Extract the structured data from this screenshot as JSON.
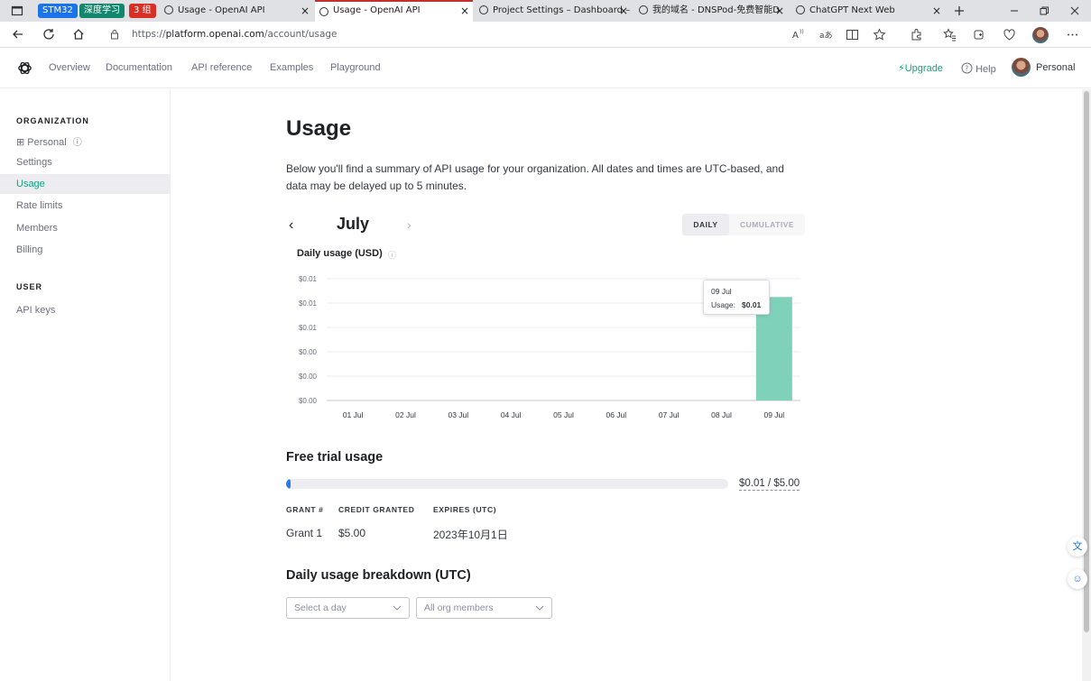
{
  "browser": {
    "tab_groups": [
      {
        "label": "STM32",
        "color": "#1a73e8"
      },
      {
        "label": "深度学习",
        "color": "#12876e"
      },
      {
        "label": "3 组",
        "color": "#d93025"
      }
    ],
    "tabs": [
      {
        "title": "Usage - OpenAI API",
        "active": false
      },
      {
        "title": "Usage - OpenAI API",
        "active": true
      },
      {
        "title": "Project Settings – Dashboard – ",
        "active": false
      },
      {
        "title": "我的域名 - DNSPod-免费智能D",
        "active": false
      },
      {
        "title": "ChatGPT Next Web",
        "active": false
      }
    ],
    "url_prefix": "https://",
    "url_host": "platform.openai.com",
    "url_path": "/account/usage"
  },
  "header": {
    "nav": [
      "Overview",
      "Documentation",
      "API reference",
      "Examples",
      "Playground"
    ],
    "upgrade": "Upgrade",
    "help": "Help",
    "account": "Personal"
  },
  "sidebar": {
    "org_heading": "ORGANIZATION",
    "org_name": "Personal",
    "org_items": [
      {
        "label": "Settings",
        "active": false
      },
      {
        "label": "Usage",
        "active": true
      },
      {
        "label": "Rate limits",
        "active": false
      },
      {
        "label": "Members",
        "active": false
      },
      {
        "label": "Billing",
        "active": false
      }
    ],
    "user_heading": "USER",
    "user_items": [
      {
        "label": "API keys",
        "active": false
      }
    ]
  },
  "main": {
    "title": "Usage",
    "description": "Below you'll find a summary of API usage for your organization. All dates and times are UTC-based, and data may be delayed up to 5 minutes.",
    "month": "July",
    "toggle": {
      "daily": "DAILY",
      "cumulative": "CUMULATIVE",
      "selected": "daily"
    },
    "chart_title": "Daily usage (USD)",
    "tooltip": {
      "date": "09 Jul",
      "label": "Usage:",
      "value": "$0.01"
    },
    "free_trial": {
      "title": "Free trial usage",
      "used_fraction": 0.002,
      "text": "$0.01 / $5.00"
    },
    "grants": {
      "headers": [
        "GRANT #",
        "CREDIT GRANTED",
        "EXPIRES (UTC)"
      ],
      "rows": [
        [
          "Grant 1",
          "$5.00",
          "2023年10月1日"
        ]
      ]
    },
    "breakdown": {
      "title": "Daily usage breakdown (UTC)",
      "day_placeholder": "Select a day",
      "members_value": "All org members"
    }
  },
  "colors": {
    "accent": "#10a37f",
    "bar": "#7fd1ba",
    "progress": "#2a7de1"
  },
  "chart_data": {
    "type": "bar",
    "title": "Daily usage (USD)",
    "categories": [
      "01 Jul",
      "02 Jul",
      "03 Jul",
      "04 Jul",
      "05 Jul",
      "06 Jul",
      "07 Jul",
      "08 Jul",
      "09 Jul"
    ],
    "values": [
      0,
      0,
      0,
      0,
      0,
      0,
      0,
      0,
      0.0085
    ],
    "y_ticks": [
      "$0.01",
      "$0.01",
      "$0.01",
      "$0.00",
      "$0.00",
      "$0.00"
    ],
    "ylim": [
      0,
      0.01
    ],
    "grid": true
  }
}
